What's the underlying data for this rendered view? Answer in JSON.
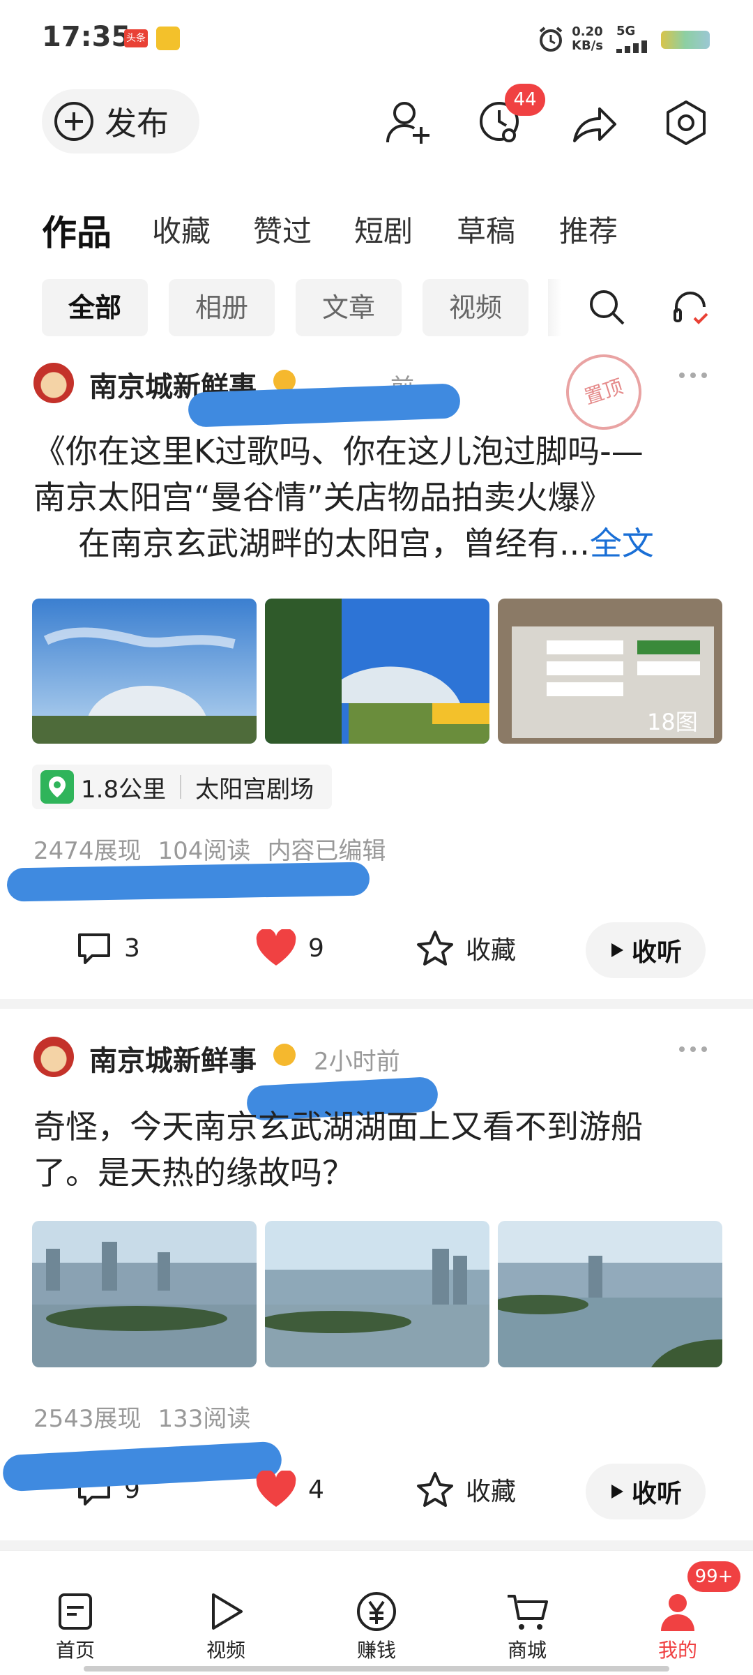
{
  "status_bar": {
    "time": "17:35",
    "app_badge": "头条",
    "net_speed": "0.20",
    "net_unit": "KB/s",
    "network": "5G"
  },
  "top_actions": {
    "publish_label": "发布",
    "notification_count": "44"
  },
  "tabs": [
    "作品",
    "收藏",
    "赞过",
    "短剧",
    "草稿",
    "推荐"
  ],
  "filters": [
    "全部",
    "相册",
    "文章",
    "视频"
  ],
  "posts": [
    {
      "author": "南京城新鲜事",
      "time": "前",
      "pinned_stamp": "置顶",
      "title_line1": "《你在这里K过歌吗、你在这儿泡过脚吗-—",
      "title_line2": "南京太阳宫“曼谷情”关店物品拍卖火爆》",
      "excerpt": "在南京玄武湖畔的太阳宫，曾经有...",
      "full_text_link": "全文",
      "image_count": "18图",
      "location_distance": "1.8公里",
      "location_name": "太阳宫剧场",
      "views": "2474展现",
      "reads": "104阅读",
      "edited": "内容已编辑",
      "comments": "3",
      "likes": "9",
      "favorite_label": "收藏",
      "listen_label": "收听"
    },
    {
      "author": "南京城新鲜事",
      "time": "2小时前",
      "title_line1": "奇怪，今天南京玄武湖湖面上又看不到游船",
      "title_line2": "了。是天热的缘故吗？",
      "views": "2543展现",
      "reads": "133阅读",
      "comments": "9",
      "likes": "4",
      "favorite_label": "收藏",
      "listen_label": "收听"
    }
  ],
  "bottom_nav": [
    {
      "label": "首页",
      "icon": "document-icon"
    },
    {
      "label": "视频",
      "icon": "play-icon"
    },
    {
      "label": "赚钱",
      "icon": "yuan-icon"
    },
    {
      "label": "商城",
      "icon": "cart-icon"
    },
    {
      "label": "我的",
      "icon": "person-icon",
      "badge": "99+"
    }
  ],
  "colors": {
    "accent_red": "#f04142",
    "link_blue": "#1a6fd6"
  }
}
